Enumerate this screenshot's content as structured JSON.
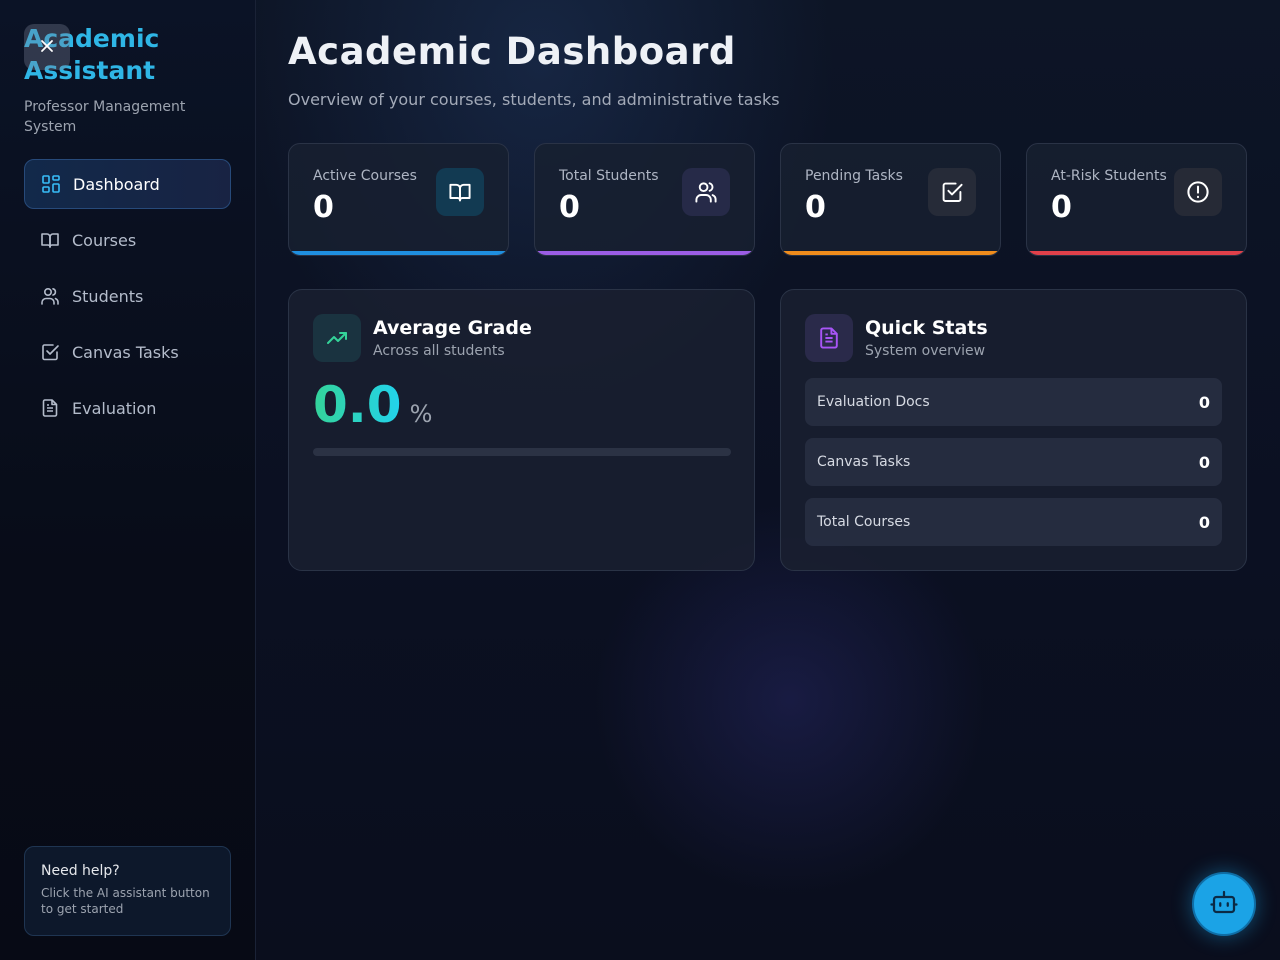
{
  "sidebar": {
    "brand_title": "Academic Assistant",
    "brand_subtitle": "Professor Management System",
    "items": [
      {
        "label": "Dashboard",
        "icon": "grid-icon",
        "active": true
      },
      {
        "label": "Courses",
        "icon": "book-icon",
        "active": false
      },
      {
        "label": "Students",
        "icon": "users-icon",
        "active": false
      },
      {
        "label": "Canvas Tasks",
        "icon": "check-square-icon",
        "active": false
      },
      {
        "label": "Evaluation",
        "icon": "document-icon",
        "active": false
      }
    ],
    "help": {
      "title": "Need help?",
      "text": "Click the AI assistant button to get started"
    }
  },
  "header": {
    "title": "Academic Dashboard",
    "subtitle": "Overview of your courses, students, and administrative tasks"
  },
  "stats": [
    {
      "label": "Active Courses",
      "value": "0",
      "icon": "book-icon",
      "color": "#1f8fe0"
    },
    {
      "label": "Total Students",
      "value": "0",
      "icon": "users-icon",
      "color": "#9b5de5"
    },
    {
      "label": "Pending Tasks",
      "value": "0",
      "icon": "check-square-icon",
      "color": "#f08c1c"
    },
    {
      "label": "At-Risk Students",
      "value": "0",
      "icon": "alert-circle-icon",
      "color": "#e0404a"
    }
  ],
  "average_grade": {
    "title": "Average Grade",
    "subtitle": "Across all students",
    "value": "0.0",
    "unit": "%",
    "progress": 0
  },
  "quick_stats": {
    "title": "Quick Stats",
    "subtitle": "System overview",
    "rows": [
      {
        "label": "Evaluation Docs",
        "value": "0"
      },
      {
        "label": "Canvas Tasks",
        "value": "0"
      },
      {
        "label": "Total Courses",
        "value": "0"
      }
    ]
  },
  "colors": {
    "accent": "#2fb6e6",
    "grade_gradient_start": "#34d399",
    "grade_gradient_end": "#22d3ee",
    "fab": "#1ba3e6"
  },
  "fab": {
    "icon": "bot-icon"
  }
}
